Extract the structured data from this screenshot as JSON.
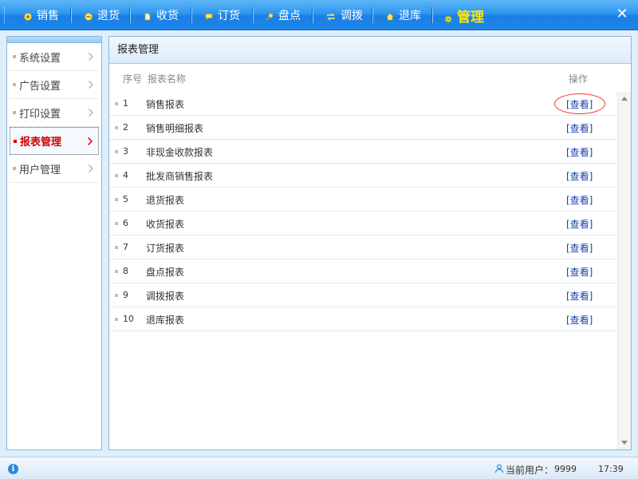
{
  "nav": {
    "items": [
      {
        "label": "销售",
        "icon": "plus-circle-icon"
      },
      {
        "label": "退货",
        "icon": "minus-circle-icon"
      },
      {
        "label": "收货",
        "icon": "document-icon"
      },
      {
        "label": "订货",
        "icon": "comment-icon"
      },
      {
        "label": "盘点",
        "icon": "key-icon"
      },
      {
        "label": "调拨",
        "icon": "swap-arrows-icon"
      },
      {
        "label": "退库",
        "icon": "home-icon"
      },
      {
        "label": "管理",
        "icon": "gear-icon",
        "active": true
      }
    ],
    "close_label": "✕"
  },
  "sidebar": {
    "items": [
      {
        "label": "系统设置"
      },
      {
        "label": "广告设置"
      },
      {
        "label": "打印设置"
      },
      {
        "label": "报表管理",
        "active": true
      },
      {
        "label": "用户管理"
      }
    ]
  },
  "panel": {
    "title": "报表管理",
    "columns": {
      "seq": "序号",
      "name": "报表名称",
      "op": "操作"
    },
    "rows": [
      {
        "seq": "1",
        "name": "销售报表",
        "action": "[查看]"
      },
      {
        "seq": "2",
        "name": "销售明细报表",
        "action": "[查看]"
      },
      {
        "seq": "3",
        "name": "非现金收款报表",
        "action": "[查看]"
      },
      {
        "seq": "4",
        "name": "批发商销售报表",
        "action": "[查看]"
      },
      {
        "seq": "5",
        "name": "退货报表",
        "action": "[查看]"
      },
      {
        "seq": "6",
        "name": "收货报表",
        "action": "[查看]"
      },
      {
        "seq": "7",
        "name": "订货报表",
        "action": "[查看]"
      },
      {
        "seq": "8",
        "name": "盘点报表",
        "action": "[查看]"
      },
      {
        "seq": "9",
        "name": "调拨报表",
        "action": "[查看]"
      },
      {
        "seq": "10",
        "name": "退库报表",
        "action": "[查看]"
      }
    ]
  },
  "status": {
    "info_icon": "i",
    "user_label": "当前用户：",
    "user_value": "9999",
    "time": "17:39"
  },
  "colors": {
    "topbar": "#1d86ea",
    "active_nav": "#ffe600",
    "active_sidebar": "#d40000",
    "link": "#1a3fb0",
    "highlight_circle": "#e33333"
  }
}
